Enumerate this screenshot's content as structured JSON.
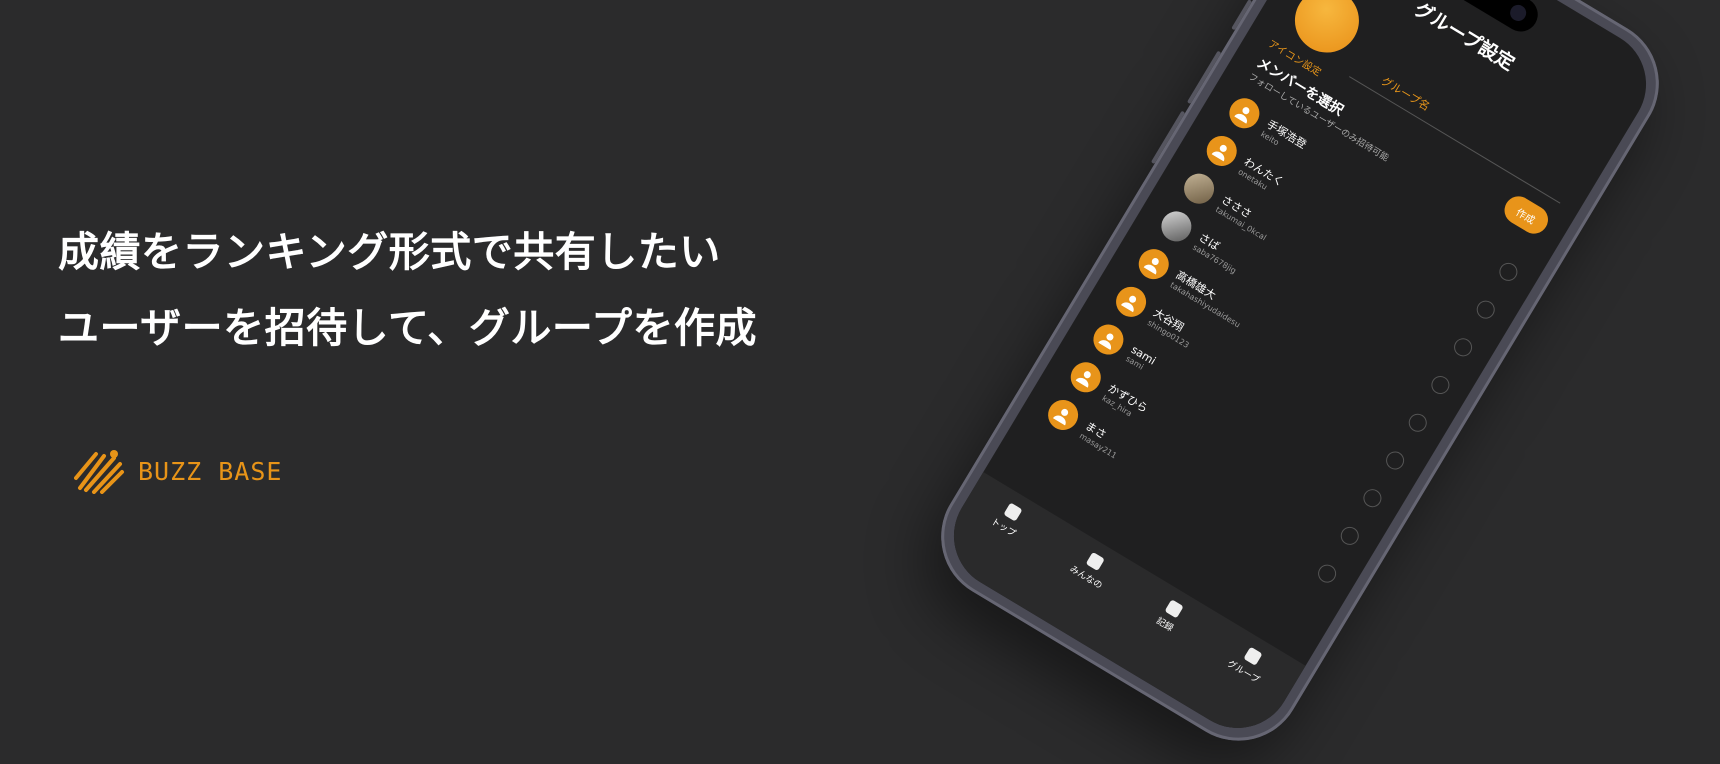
{
  "headline": {
    "line1": "成績をランキング形式で共有したい",
    "line2": "ユーザーを招待して、グループを作成"
  },
  "logo": {
    "text": "BUZZ BASE",
    "icon": "buzz-base-logo-icon",
    "color": "#e89418"
  },
  "phone": {
    "title": "グループ設定",
    "icon_setting_label": "アイコン設定",
    "group_name_label": "グループ名",
    "create_button": "作成",
    "section_title": "メンバーを選択",
    "section_subtitle": "フォローしているユーザーのみ招待可能",
    "members": [
      {
        "name": "手塚浩登",
        "id": "keito",
        "avatar": "default"
      },
      {
        "name": "わんたく",
        "id": "onetaku",
        "avatar": "default"
      },
      {
        "name": "さささ",
        "id": "takumai_0kcal",
        "avatar": "photo"
      },
      {
        "name": "さば",
        "id": "saba7678jig",
        "avatar": "photo2"
      },
      {
        "name": "高橋雄大",
        "id": "takahashiyudaidesu",
        "avatar": "default"
      },
      {
        "name": "大谷翔",
        "id": "shingo0123",
        "avatar": "default"
      },
      {
        "name": "sami",
        "id": "sami",
        "avatar": "default"
      },
      {
        "name": "かずひら",
        "id": "kaz_hira",
        "avatar": "default"
      },
      {
        "name": "まさ",
        "id": "masay211",
        "avatar": "default"
      }
    ],
    "tabs": [
      {
        "label": "トップ",
        "icon": "home-icon"
      },
      {
        "label": "みんなの",
        "icon": "people-icon"
      },
      {
        "label": "記録",
        "icon": "record-icon"
      },
      {
        "label": "グループ",
        "icon": "group-icon"
      }
    ],
    "accent": "#e8941a"
  }
}
